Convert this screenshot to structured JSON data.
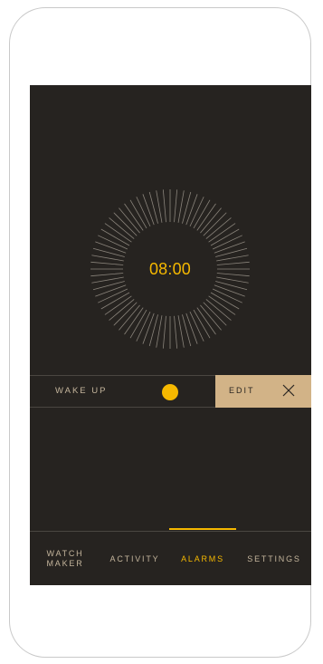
{
  "clock": {
    "time": "08:00"
  },
  "alarm": {
    "label": "WAKE UP",
    "edit_label": "EDIT",
    "enabled": true
  },
  "nav": {
    "items": [
      {
        "line1": "WATCH",
        "line2": "MAKER",
        "active": false
      },
      {
        "label": "ACTIVITY",
        "active": false
      },
      {
        "label": "ALARMS",
        "active": true
      },
      {
        "label": "SETTINGS",
        "active": false
      }
    ]
  },
  "colors": {
    "background": "#262320",
    "accent": "#f5b800",
    "text": "#c4b59c",
    "edit_panel": "#d2b387",
    "divider": "#4a4641"
  },
  "icons": {
    "close": "close-icon"
  }
}
